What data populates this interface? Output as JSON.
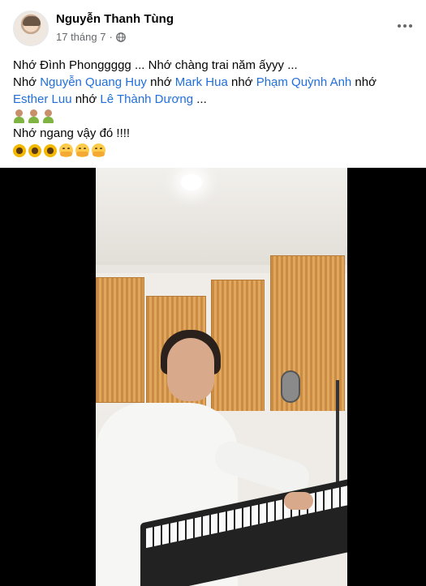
{
  "post": {
    "author": "Nguyễn Thanh Tùng",
    "timestamp": "17 tháng 7",
    "separator": "·",
    "lines": {
      "line1": "Nhớ Đình Phonggggg ... Nhớ chàng trai năm ấyyy ...",
      "line2": {
        "pre": "Nhớ ",
        "tag1": "Nguyễn Quang Huy",
        "sep1": " nhớ ",
        "tag2": "Mark Hua",
        "sep2": " nhớ ",
        "tag3": "Phạm Quỳnh Anh",
        "sep3": " nhớ"
      },
      "line3": {
        "tag4": "Esther Luu",
        "sep4": " nhớ ",
        "tag5": "Lê Thành Dương",
        "post": " ..."
      },
      "line5": "Nhớ ngang vậy đó !!!!"
    },
    "icons": {
      "privacy": "globe-icon",
      "more": "more-options-icon",
      "emoji_person": "man-farmer-emoji",
      "emoji_sunflower": "sunflower-emoji",
      "emoji_hug": "hugging-face-emoji"
    },
    "colors": {
      "tag": "#216fdb",
      "meta": "#65676b",
      "text": "#050505"
    }
  }
}
